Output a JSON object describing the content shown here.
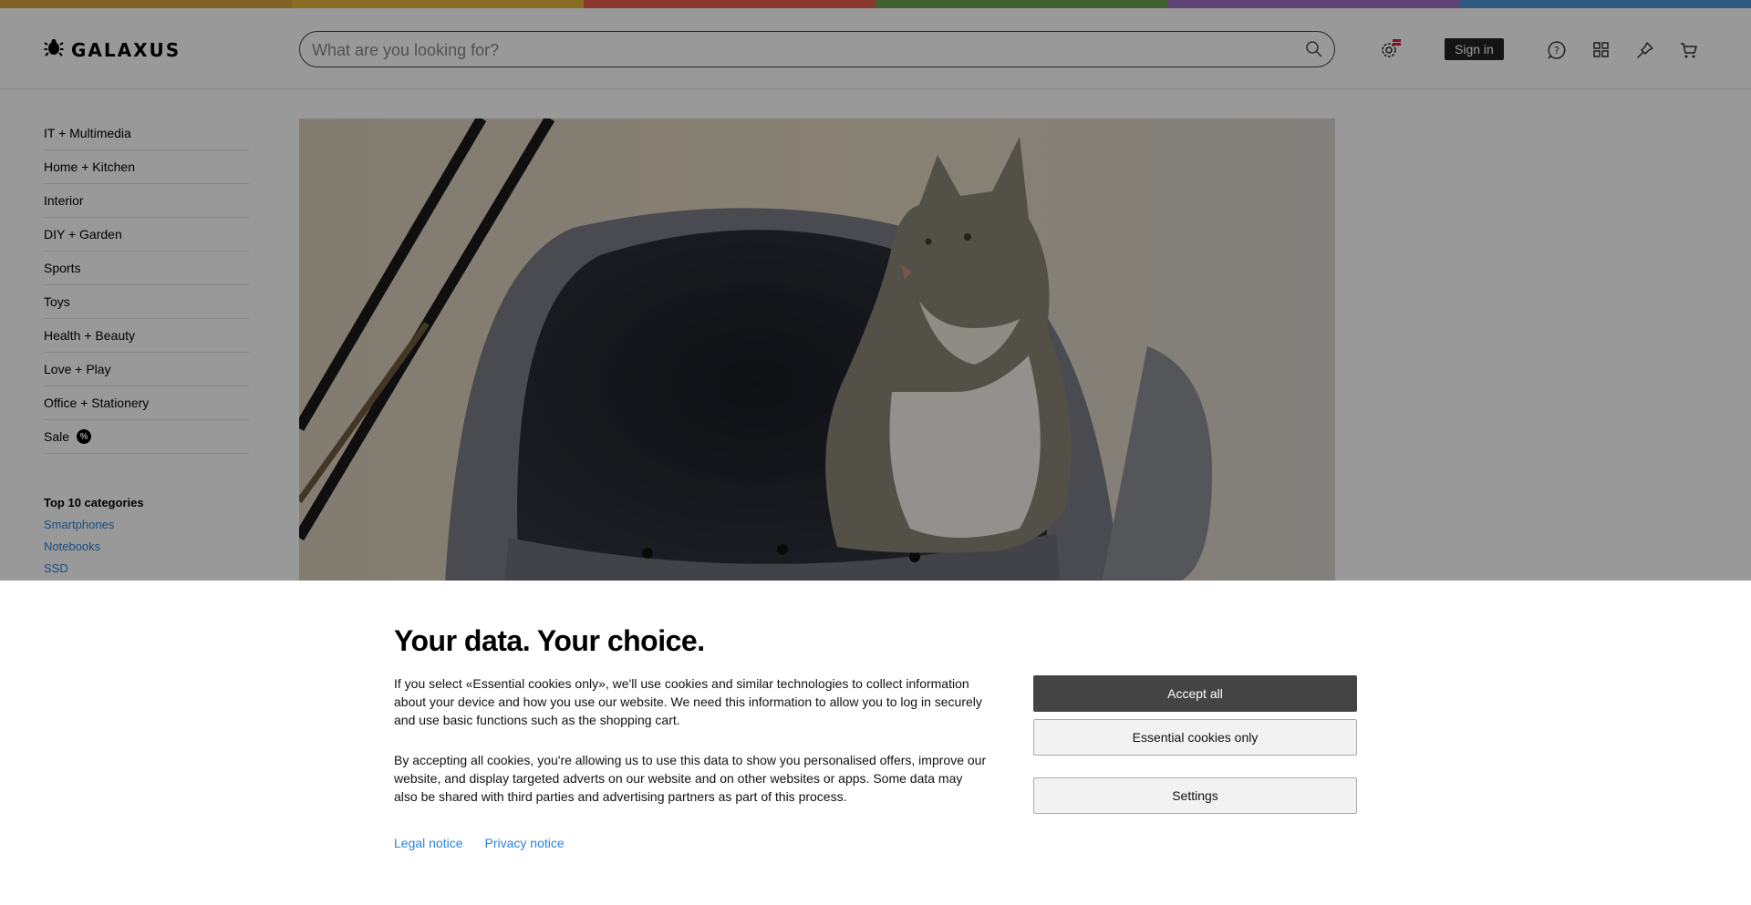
{
  "brand": {
    "name": "GALAXUS"
  },
  "rainbow_colors": [
    "#d2a63c",
    "#e3b73d",
    "#e65d4e",
    "#6da34f",
    "#9e74c0",
    "#4f94d6"
  ],
  "search": {
    "placeholder": "What are you looking for?"
  },
  "header": {
    "sign_in_label": "Sign in"
  },
  "sidebar": {
    "items": [
      {
        "label": "IT + Multimedia"
      },
      {
        "label": "Home + Kitchen"
      },
      {
        "label": "Interior"
      },
      {
        "label": "DIY + Garden"
      },
      {
        "label": "Sports"
      },
      {
        "label": "Toys"
      },
      {
        "label": "Health + Beauty"
      },
      {
        "label": "Love + Play"
      },
      {
        "label": "Office + Stationery"
      },
      {
        "label": "Sale"
      }
    ],
    "sale_badge": "%",
    "top_categories_title": "Top 10 categories",
    "top_categories": [
      "Smartphones",
      "Notebooks",
      "SSD"
    ]
  },
  "consent": {
    "title": "Your data. Your choice.",
    "paragraph1": "If you select «Essential cookies only», we'll use cookies and similar technologies to collect information about your device and how you use our website. We need this information to allow you to log in securely and use basic functions such as the shopping cart.",
    "paragraph2": "By accepting all cookies, you're allowing us to use this data to show you personalised offers, improve our website, and display targeted adverts on our website and on other websites or apps. Some data may also be shared with third parties and advertising partners as part of this process.",
    "legal_notice": "Legal notice",
    "privacy_notice": "Privacy notice",
    "accept_all": "Accept all",
    "essential_only": "Essential cookies only",
    "settings": "Settings"
  },
  "icons": {
    "logo": "bug-icon",
    "search": "search-icon",
    "settings": "gear-icon",
    "help": "help-icon",
    "compare": "grid-icon",
    "wishlist": "pin-icon",
    "cart": "cart-icon"
  }
}
